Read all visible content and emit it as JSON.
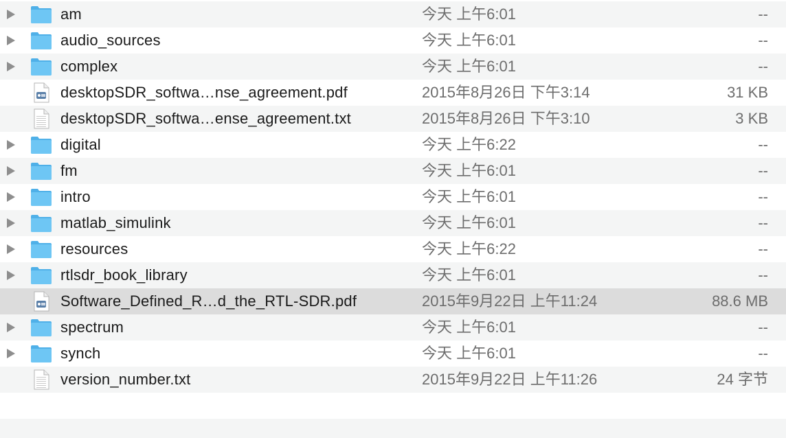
{
  "files": [
    {
      "name": "am",
      "date": "今天 上午6:01",
      "size": "--",
      "kind": "folder"
    },
    {
      "name": "audio_sources",
      "date": "今天 上午6:01",
      "size": "--",
      "kind": "folder"
    },
    {
      "name": "complex",
      "date": "今天 上午6:01",
      "size": "--",
      "kind": "folder"
    },
    {
      "name": "desktopSDR_softwa…nse_agreement.pdf",
      "date": "2015年8月26日 下午3:14",
      "size": "31 KB",
      "kind": "pdf"
    },
    {
      "name": "desktopSDR_softwa…ense_agreement.txt",
      "date": "2015年8月26日 下午3:10",
      "size": "3 KB",
      "kind": "txt"
    },
    {
      "name": "digital",
      "date": "今天 上午6:22",
      "size": "--",
      "kind": "folder"
    },
    {
      "name": "fm",
      "date": "今天 上午6:01",
      "size": "--",
      "kind": "folder"
    },
    {
      "name": "intro",
      "date": "今天 上午6:01",
      "size": "--",
      "kind": "folder"
    },
    {
      "name": "matlab_simulink",
      "date": "今天 上午6:01",
      "size": "--",
      "kind": "folder"
    },
    {
      "name": "resources",
      "date": "今天 上午6:22",
      "size": "--",
      "kind": "folder"
    },
    {
      "name": "rtlsdr_book_library",
      "date": "今天 上午6:01",
      "size": "--",
      "kind": "folder"
    },
    {
      "name": "Software_Defined_R…d_the_RTL-SDR.pdf",
      "date": "2015年9月22日 上午11:24",
      "size": "88.6 MB",
      "kind": "pdf",
      "selected": true
    },
    {
      "name": "spectrum",
      "date": "今天 上午6:01",
      "size": "--",
      "kind": "folder"
    },
    {
      "name": "synch",
      "date": "今天 上午6:01",
      "size": "--",
      "kind": "folder"
    },
    {
      "name": "version_number.txt",
      "date": "2015年9月22日 上午11:26",
      "size": "24 字节",
      "kind": "txt"
    }
  ],
  "colors": {
    "folder": "#6ec6f4",
    "folder_dark": "#4fb0e8",
    "row_alt": "#f4f5f5",
    "selected": "#dcdcdc",
    "text": "#1a1a1a",
    "muted": "#6d6d6d"
  }
}
